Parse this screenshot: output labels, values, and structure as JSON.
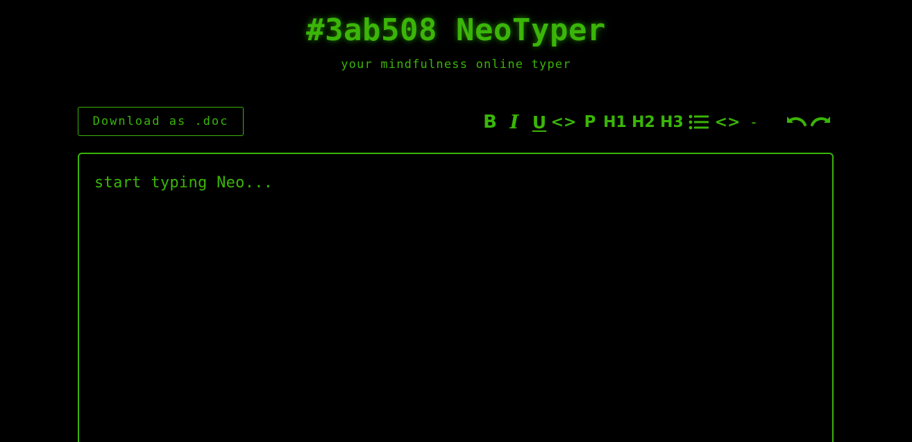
{
  "header": {
    "title": "#3ab508 NeoTyper",
    "subtitle": "your mindfulness online typer"
  },
  "actions": {
    "download_label": "Download as .doc"
  },
  "toolbar": {
    "bold_label": "B",
    "italic_label": "I",
    "underline_label": "U",
    "code_label": "<>",
    "paragraph_label": "P",
    "h1_label": "H1",
    "h2_label": "H2",
    "h3_label": "H3",
    "code_block_label": "<>",
    "hr_label": "-",
    "icons": [
      "bold-icon",
      "italic-icon",
      "underline-icon",
      "code-icon",
      "paragraph-icon",
      "heading-1-icon",
      "heading-2-icon",
      "heading-3-icon",
      "list-icon",
      "code-block-icon",
      "horizontal-rule-icon",
      "undo-icon",
      "redo-icon"
    ]
  },
  "editor": {
    "placeholder": "start typing Neo..."
  },
  "colors": {
    "accent": "#3ab508",
    "background": "#000000"
  }
}
